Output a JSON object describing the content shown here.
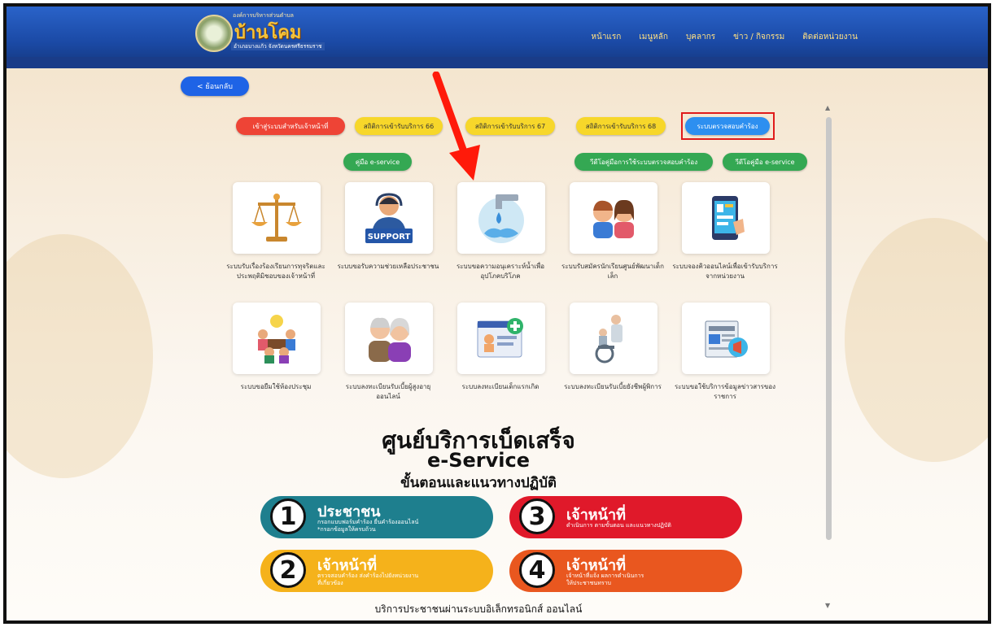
{
  "header": {
    "logo_top": "องค์การบริหารส่วนตำบล",
    "logo_main": "บ้านโคม",
    "logo_sub": "อำเภอบางแก้ว จังหวัดนครศรีธรรมราช",
    "nav": [
      "หน้าแรก",
      "เมนูหลัก",
      "บุคลากร",
      "ข่าว / กิจกรรม",
      "ติดต่อหน่วยงาน"
    ]
  },
  "back_button": "< ย้อนกลับ",
  "pills_row1": [
    "เข้าสู่ระบบสำหรับเจ้าหน้าที่",
    "สถิติการเข้ารับบริการ 66",
    "สถิติการเข้ารับบริการ 67",
    "สถิติการเข้ารับบริการ 68",
    "ระบบตรวจสอบคำร้อง"
  ],
  "pills_row2": [
    "คู่มือ e-service",
    "วีดีโอคู่มือการใช้ระบบตรวจสอบคำร้อง",
    "วีดีโอคู่มือ e-service"
  ],
  "services_row1": [
    {
      "label": "ระบบรับเรื่องร้องเรียนการทุจริตและประพฤติมิชอบของเจ้าหน้าที่",
      "icon": "scales-icon"
    },
    {
      "label": "ระบบขอรับความช่วยเหลือประชาชน",
      "icon": "support-icon",
      "icon_text": "SUPPORT"
    },
    {
      "label": "ระบบขอความอนุเคราะห์น้ำเพื่ออุปโภคบริโภค",
      "icon": "water-tap-icon"
    },
    {
      "label": "ระบบรับสมัครนักเรียนศูนย์พัฒนาเด็กเล็ก",
      "icon": "children-icon"
    },
    {
      "label": "ระบบจองคิวออนไลน์เพื่อเข้ารับบริการจากหน่วยงาน",
      "icon": "mobile-queue-icon"
    }
  ],
  "services_row2": [
    {
      "label": "ระบบขอยืมใช้ห้องประชุม",
      "icon": "meeting-icon"
    },
    {
      "label": "ระบบลงทะเบียนรับเบี้ยผู้สูงอายุออนไลน์",
      "icon": "elderly-icon"
    },
    {
      "label": "ระบบลงทะเบียนเด็กแรกเกิด",
      "icon": "registration-icon"
    },
    {
      "label": "ระบบลงทะเบียนรับเบี้ยยังชีพผู้พิการ",
      "icon": "wheelchair-icon"
    },
    {
      "label": "ระบบขอใช้บริการข้อมูลข่าวสารของราชการ",
      "icon": "news-icon"
    }
  ],
  "center": {
    "title": "ศูนย์บริการเบ็ดเสร็จ",
    "subtitle": "e-Service",
    "steps_title": "ขั้นตอนและแนวทางปฏิบัติ"
  },
  "steps": [
    {
      "num": "1",
      "title": "ประชาชน",
      "desc1": "กรอกแบบฟอร์มคำร้อง ยื่นคำร้องออนไลน์",
      "desc2": "*กรอกข้อมูลให้ครบถ้วน",
      "color": "#1e7f8e"
    },
    {
      "num": "3",
      "title": "เจ้าหน้าที่",
      "desc1": "ดำเนินการ ตามขั้นตอน และแนวทางปฏิบัติ",
      "desc2": "",
      "color": "#e0192a"
    },
    {
      "num": "2",
      "title": "เจ้าหน้าที่",
      "desc1": "ตรวจสอบคำร้อง ส่งคำร้องไปยังหน่วยงาน",
      "desc2": "ที่เกี่ยวข้อง",
      "color": "#f5b21b"
    },
    {
      "num": "4",
      "title": "เจ้าหน้าที่",
      "desc1": "เจ้าหน้าที่แจ้ง ผลการดำเนินการ",
      "desc2": "ให้ประชาชนทราบ",
      "color": "#e9571f"
    }
  ],
  "footer_text": "บริการประชาชนผ่านระบบอิเล็กทรอนิกส์ ออนไลน์"
}
